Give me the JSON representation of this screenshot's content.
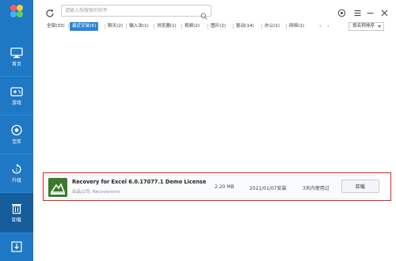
{
  "sidebar": {
    "items": [
      {
        "label": "首页",
        "icon": "monitor-icon"
      },
      {
        "label": "游戏",
        "icon": "gamepad-icon"
      },
      {
        "label": "宝库",
        "icon": "treasure-icon"
      },
      {
        "label": "升级",
        "icon": "upgrade-icon"
      },
      {
        "label": "卸载",
        "icon": "trash-icon"
      }
    ],
    "bottom_icon": "download-icon",
    "accent": "#1e78c4",
    "active_bg": "#155c9b"
  },
  "topbar": {
    "search_placeholder": "请输入想搜索的软件"
  },
  "tabs": [
    {
      "label": "全部(33)"
    },
    {
      "label": "最近安装(6)",
      "active": true
    },
    {
      "label": "聊天(2)"
    },
    {
      "label": "输入法(1)"
    },
    {
      "label": "浏览器(1)"
    },
    {
      "label": "视频(2)"
    },
    {
      "label": "图片(2)"
    },
    {
      "label": "驱动(14)"
    },
    {
      "label": "办公(1)"
    },
    {
      "label": "网络(1)"
    }
  ],
  "sort": {
    "label": "按名称排序"
  },
  "app": {
    "name": "Recovery for Excel 6.0.17077.1 Demo License",
    "publisher": "出品公司: Recoveronix",
    "size": "2.20 MB",
    "date": "2021/01/07安装",
    "usage": "3天内使用过",
    "uninstall_label": "卸载"
  },
  "colors": {
    "tab_active": "#2b86d6",
    "highlight_border": "#e02222",
    "app_icon_bg": "#3b7a2c"
  }
}
